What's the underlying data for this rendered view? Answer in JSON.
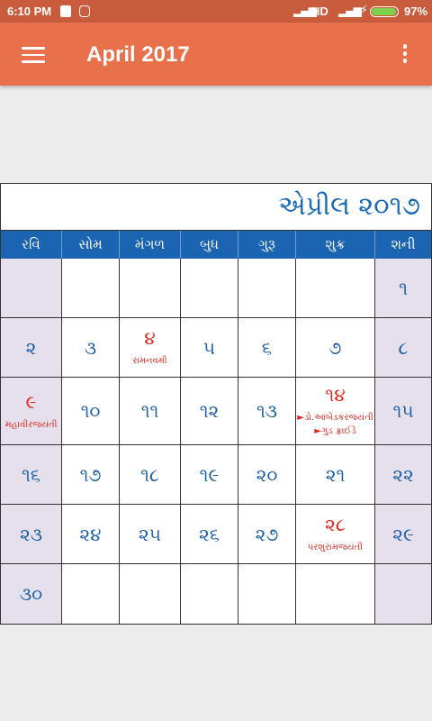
{
  "status_bar": {
    "time": "6:10 PM",
    "network": "HD",
    "battery": "97%",
    "battery_level": 0.97
  },
  "app_bar": {
    "title": "April 2017"
  },
  "calendar": {
    "title": "એપ્રીલ ૨૦૧૭",
    "weekdays": [
      "રવિ",
      "સોમ",
      "મંગળ",
      "બુધ",
      "ગુરૂ",
      "શુક્ર",
      "શની"
    ],
    "weeks": [
      [
        {
          "day": "",
          "events": []
        },
        {
          "day": "",
          "events": []
        },
        {
          "day": "",
          "events": []
        },
        {
          "day": "",
          "events": []
        },
        {
          "day": "",
          "events": []
        },
        {
          "day": "",
          "events": []
        },
        {
          "day": "૧",
          "events": []
        }
      ],
      [
        {
          "day": "૨",
          "events": []
        },
        {
          "day": "૩",
          "events": []
        },
        {
          "day": "૪",
          "events": [
            "રામનવમી"
          ],
          "holiday": true
        },
        {
          "day": "૫",
          "events": []
        },
        {
          "day": "૬",
          "events": []
        },
        {
          "day": "૭",
          "events": []
        },
        {
          "day": "૮",
          "events": []
        }
      ],
      [
        {
          "day": "૯",
          "events": [
            "મહાવીરજયંતી"
          ],
          "holiday": true
        },
        {
          "day": "૧૦",
          "events": []
        },
        {
          "day": "૧૧",
          "events": []
        },
        {
          "day": "૧૨",
          "events": []
        },
        {
          "day": "૧૩",
          "events": []
        },
        {
          "day": "૧૪",
          "events": [
            "►ડો.આંબેડકરજયંતી",
            "►ગુડ ફ્રાઈડે"
          ],
          "holiday": true
        },
        {
          "day": "૧૫",
          "events": []
        }
      ],
      [
        {
          "day": "૧૬",
          "events": []
        },
        {
          "day": "૧૭",
          "events": []
        },
        {
          "day": "૧૮",
          "events": []
        },
        {
          "day": "૧૯",
          "events": []
        },
        {
          "day": "૨૦",
          "events": []
        },
        {
          "day": "૨૧",
          "events": []
        },
        {
          "day": "૨૨",
          "events": []
        }
      ],
      [
        {
          "day": "૨૩",
          "events": []
        },
        {
          "day": "૨૪",
          "events": []
        },
        {
          "day": "૨૫",
          "events": []
        },
        {
          "day": "૨૬",
          "events": []
        },
        {
          "day": "૨૭",
          "events": []
        },
        {
          "day": "૨૮",
          "events": [
            "પરશુરામજયંતી"
          ],
          "holiday": true
        },
        {
          "day": "૨૯",
          "events": []
        }
      ],
      [
        {
          "day": "૩૦",
          "events": []
        },
        {
          "day": "",
          "events": []
        },
        {
          "day": "",
          "events": []
        },
        {
          "day": "",
          "events": []
        },
        {
          "day": "",
          "events": []
        },
        {
          "day": "",
          "events": []
        },
        {
          "day": "",
          "events": []
        }
      ]
    ]
  },
  "colors": {
    "status_bar": "#c85c3c",
    "app_bar": "#e8704a",
    "weekday_header": "#1b64b2",
    "date_number": "#1b5fa8",
    "holiday": "#e1231b",
    "weekend_cell": "#e5e0ec"
  }
}
